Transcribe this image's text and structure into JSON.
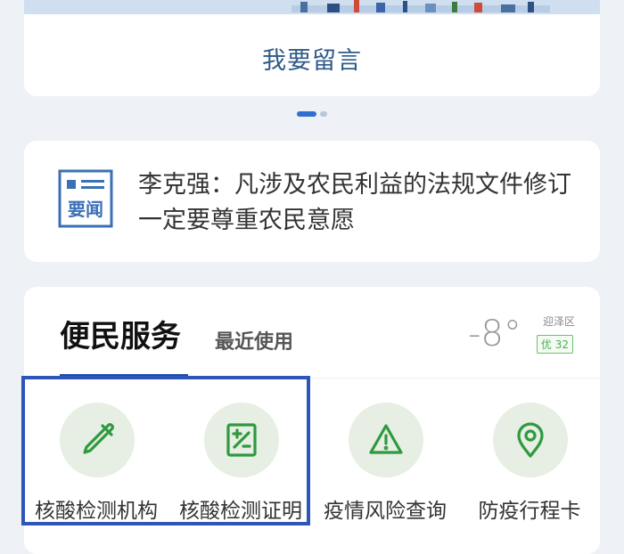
{
  "leave_message": {
    "label": "我要留言"
  },
  "carousel": {
    "active_index": 0,
    "count": 2
  },
  "news": {
    "icon_text": "要闻",
    "headline": "李克强：凡涉及农民利益的法规文件修订一定要尊重农民意愿"
  },
  "services": {
    "title": "便民服务",
    "recent_tab": "最近使用",
    "weather": {
      "temperature": "-8°",
      "district": "迎泽区",
      "aqi": "优 32"
    },
    "items": [
      {
        "label": "核酸检测机构",
        "icon": "dropper-icon"
      },
      {
        "label": "核酸检测证明",
        "icon": "certificate-icon"
      },
      {
        "label": "疫情风险查询",
        "icon": "warning-icon"
      },
      {
        "label": "防疫行程卡",
        "icon": "location-pin-icon"
      }
    ],
    "accent_color": "#2e9a3e"
  },
  "highlight_color": "#2e55b8"
}
